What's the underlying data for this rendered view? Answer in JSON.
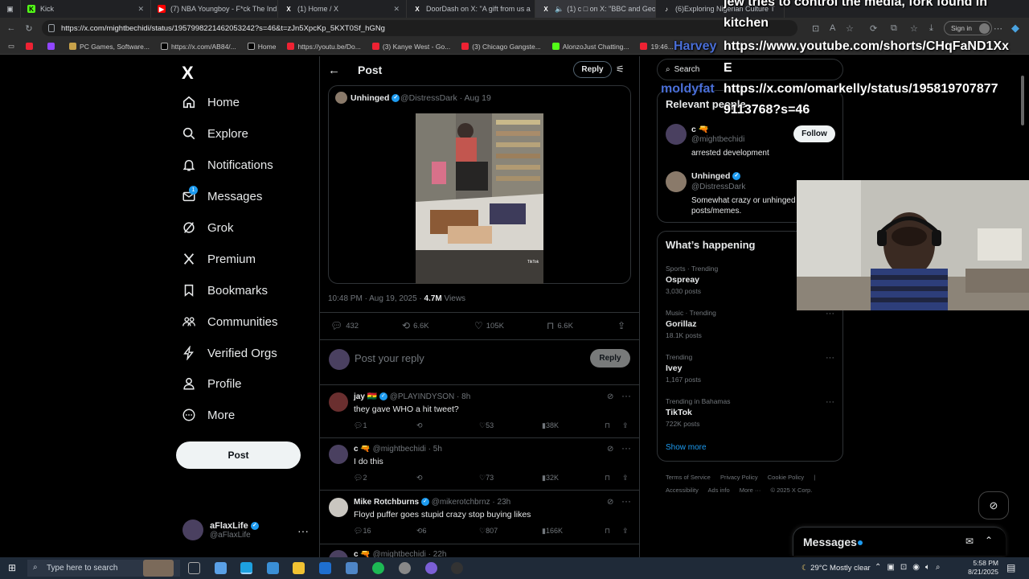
{
  "browser": {
    "tabs": [
      {
        "title": "Kick",
        "color": "#53fc18"
      },
      {
        "title": "(7) NBA Youngboy - F*ck The Ind",
        "color": "#ff0000"
      },
      {
        "title": "(1) Home / X",
        "color": "#ffffff"
      },
      {
        "title": "DoorDash on X: \"A gift from us a",
        "color": "#ffffff"
      },
      {
        "title": "(1) c □ on X: \"BBC and Geo",
        "color": "#ffffff"
      },
      {
        "title": "(6)Exploring Nigerian Culture T",
        "color": "#ffffff"
      }
    ],
    "url": "https://x.com/mightbechidi/status/1957998221462053242?s=46&t=zJn5XpcKp_5KXT0Sf_hGNg",
    "sign_in": "Sign in",
    "bookmarks": [
      "PC Games, Software...",
      "https://x.com/AB84/...",
      "Home",
      "https://youtu.be/Do...",
      "(3) Kanye West - Go...",
      "(3) Chicago Gangste...",
      "AlonzoJust Chatting...",
      "19:46..."
    ]
  },
  "stream_overlay": {
    "line1": "jew tries to control the media, fork found in",
    "line2": "kitchen",
    "user1": "Harvey",
    "url1": "https://www.youtube.com/shorts/CHqFaND1Xx",
    "url1_cont": "E",
    "user2": "moldyfat",
    "url2": "https://x.com/omarkelly/status/195819707877",
    "url2_cont": "9113768?s=46"
  },
  "sidenav": {
    "logo": "X",
    "items": [
      {
        "label": "Home"
      },
      {
        "label": "Explore"
      },
      {
        "label": "Notifications"
      },
      {
        "label": "Messages",
        "badge": "1"
      },
      {
        "label": "Grok"
      },
      {
        "label": "Premium"
      },
      {
        "label": "Bookmarks"
      },
      {
        "label": "Communities"
      },
      {
        "label": "Verified Orgs"
      },
      {
        "label": "Profile"
      },
      {
        "label": "More"
      }
    ],
    "post_label": "Post",
    "account": {
      "name": "aFlaxLife",
      "handle": "@aFlaxLife"
    }
  },
  "post": {
    "header_title": "Post",
    "reply_label": "Reply",
    "quote": {
      "name": "Unhinged",
      "handle": "@DistressDark",
      "date": "Aug 19"
    },
    "video_watermark": "TikTok",
    "time": "10:48 PM · Aug 19, 2025 ·",
    "views": "4.7M",
    "views_label": "Views",
    "stats": {
      "replies": "432",
      "reposts": "6.6K",
      "likes": "105K",
      "bookmarks": "6.6K"
    },
    "reply_placeholder": "Post your reply",
    "reply_button": "Reply"
  },
  "replies": [
    {
      "name": "jay 🇬🇭",
      "handle": "@PLAYINDYSON",
      "time": "8h",
      "text": "they gave WHO a hit tweet?",
      "replies": "1",
      "reposts": "",
      "likes": "53",
      "views": "38K",
      "verified": true
    },
    {
      "name": "c 🔫",
      "handle": "@mightbechidi",
      "time": "5h",
      "text": "I do this",
      "replies": "2",
      "reposts": "",
      "likes": "73",
      "views": "32K",
      "verified": false
    },
    {
      "name": "Mike Rotchburns",
      "handle": "@mikerotchbrnz",
      "time": "23h",
      "text": "Floyd puffer goes stupid crazy stop buying likes",
      "replies": "16",
      "reposts": "6",
      "likes": "807",
      "views": "166K",
      "verified": true
    },
    {
      "name": "c 🔫",
      "handle": "@mightbechidi",
      "time": "22h",
      "text": "",
      "replies": "",
      "reposts": "",
      "likes": "",
      "views": "",
      "verified": false
    }
  ],
  "sidebar": {
    "search_placeholder": "Search",
    "relevant_title": "Relevant people",
    "people": [
      {
        "name": "c 🔫",
        "handle": "@mightbechidi",
        "bio": "arrested development",
        "follow": "Follow"
      },
      {
        "name": "Unhinged",
        "handle": "@DistressDark",
        "bio": "Somewhat crazy or unhinged posts/memes."
      }
    ],
    "whats_happening": "What’s happening",
    "trends": [
      {
        "context": "Sports · Trending",
        "topic": "Ospreay",
        "posts": "3,030 posts"
      },
      {
        "context": "Music · Trending",
        "topic": "Gorillaz",
        "posts": "18.1K posts"
      },
      {
        "context": "Trending",
        "topic": "Ivey",
        "posts": "1,167 posts"
      },
      {
        "context": "Trending in Bahamas",
        "topic": "TikTok",
        "posts": "722K posts"
      }
    ],
    "show_more": "Show more",
    "footer1": [
      "Terms of Service",
      "Privacy Policy",
      "Cookie Policy",
      "|"
    ],
    "footer2": [
      "Accessibility",
      "Ads info",
      "More ···",
      "© 2025 X Corp."
    ]
  },
  "messages_bar": {
    "title": "Messages"
  },
  "taskbar": {
    "search_placeholder": "Type here to search",
    "weather": "29°C  Mostly clear",
    "time": "5:58 PM",
    "date": "8/21/2025"
  }
}
